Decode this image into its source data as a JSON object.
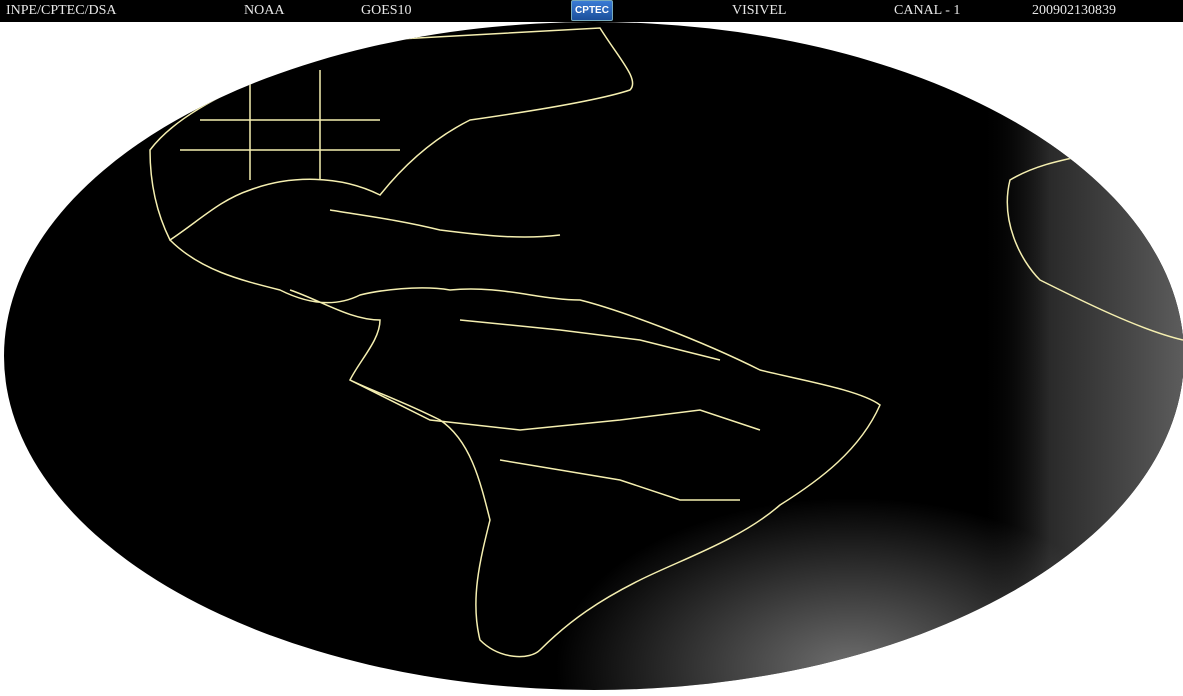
{
  "header": {
    "agency": "INPE/CPTEC/DSA",
    "source": "NOAA",
    "satellite": "GOES10",
    "logo_text": "CPTEC",
    "band": "VISIVEL",
    "channel": "CANAL - 1",
    "timestamp": "200902130839"
  },
  "colors": {
    "background": "#ffffff",
    "earth": "#000000",
    "coastline": "#f5efb0",
    "clouds": "#5a5a5a"
  }
}
